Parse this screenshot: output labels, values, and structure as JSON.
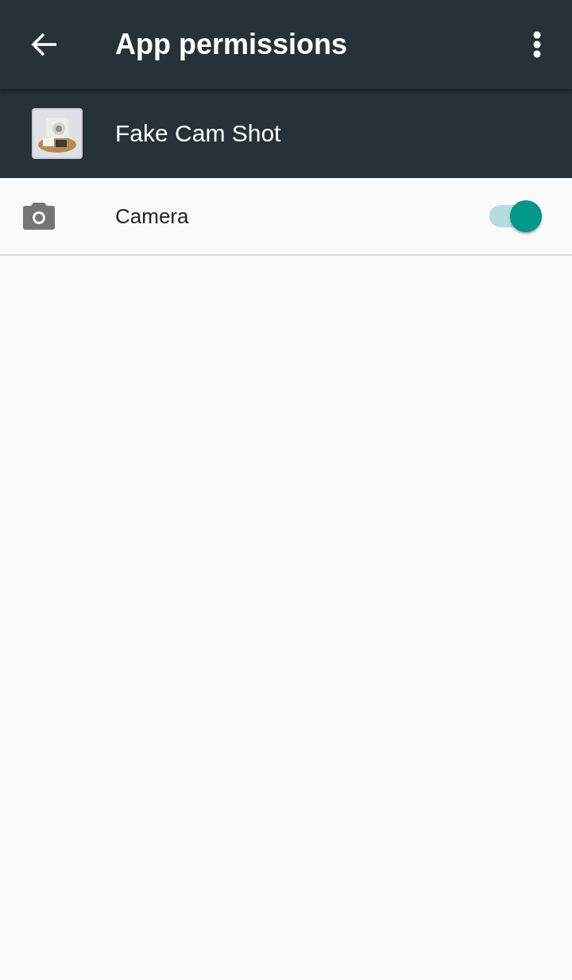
{
  "toolbar": {
    "title": "App permissions"
  },
  "app": {
    "name": "Fake Cam Shot"
  },
  "permissions": [
    {
      "label": "Camera",
      "on": true
    }
  ]
}
